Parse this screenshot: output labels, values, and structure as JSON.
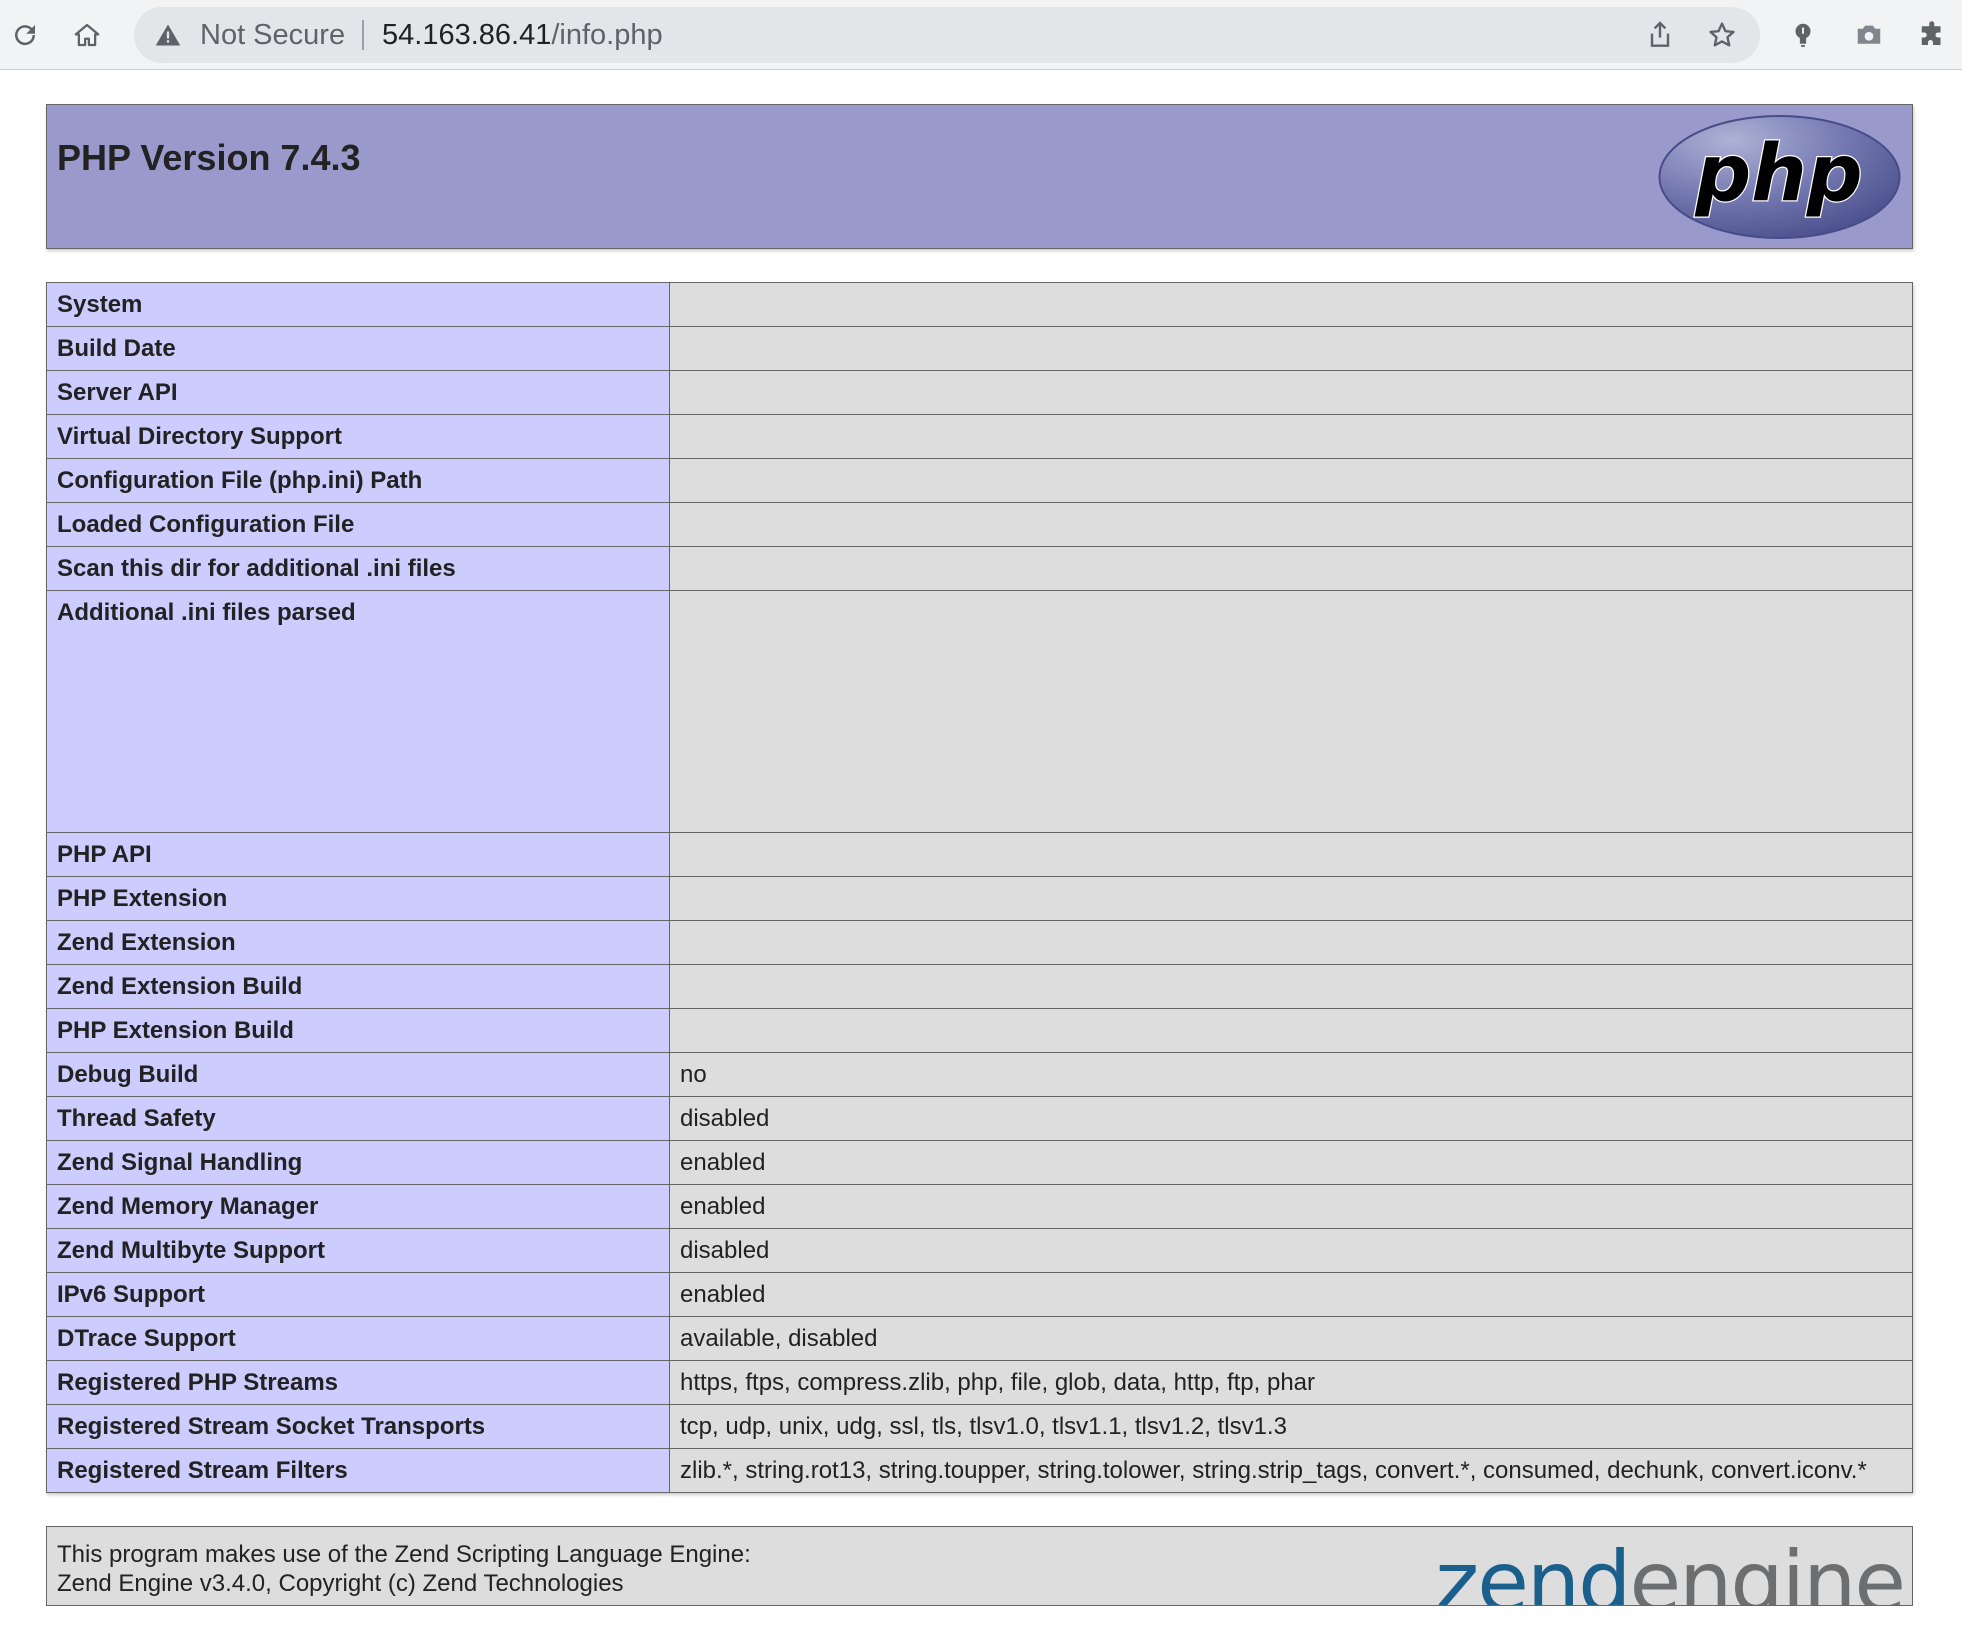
{
  "browser": {
    "security_label": "Not Secure",
    "url_host": "54.163.86.41",
    "url_path": "/info.php",
    "icons": [
      "reload-icon",
      "home-icon",
      "warning-icon",
      "share-icon",
      "bookmark-star-icon",
      "lightbulb-icon",
      "camera-icon",
      "extensions-puzzle-icon"
    ]
  },
  "page": {
    "title": "PHP Version 7.4.3",
    "logo_text": "php",
    "rows": [
      {
        "key": "System",
        "value": ""
      },
      {
        "key": "Build Date",
        "value": ""
      },
      {
        "key": "Server API",
        "value": ""
      },
      {
        "key": "Virtual Directory Support",
        "value": ""
      },
      {
        "key": "Configuration File (php.ini) Path",
        "value": ""
      },
      {
        "key": "Loaded Configuration File",
        "value": ""
      },
      {
        "key": "Scan this dir for additional .ini files",
        "value": ""
      },
      {
        "key": "Additional .ini files parsed",
        "value": ""
      },
      {
        "key": "PHP API",
        "value": ""
      },
      {
        "key": "PHP Extension",
        "value": ""
      },
      {
        "key": "Zend Extension",
        "value": ""
      },
      {
        "key": "Zend Extension Build",
        "value": ""
      },
      {
        "key": "PHP Extension Build",
        "value": ""
      },
      {
        "key": "Debug Build",
        "value": "no"
      },
      {
        "key": "Thread Safety",
        "value": "disabled"
      },
      {
        "key": "Zend Signal Handling",
        "value": "enabled"
      },
      {
        "key": "Zend Memory Manager",
        "value": "enabled"
      },
      {
        "key": "Zend Multibyte Support",
        "value": "disabled"
      },
      {
        "key": "IPv6 Support",
        "value": "enabled"
      },
      {
        "key": "DTrace Support",
        "value": "available, disabled"
      },
      {
        "key": "Registered PHP Streams",
        "value": "https, ftps, compress.zlib, php, file, glob, data, http, ftp, phar"
      },
      {
        "key": "Registered Stream Socket Transports",
        "value": "tcp, udp, unix, udg, ssl, tls, tlsv1.0, tlsv1.1, tlsv1.2, tlsv1.3"
      },
      {
        "key": "Registered Stream Filters",
        "value": "zlib.*, string.rot13, string.toupper, string.tolower, string.strip_tags, convert.*, consumed, dechunk, convert.iconv.*"
      }
    ],
    "footer": {
      "line1": "This program makes use of the Zend Scripting Language Engine:",
      "line2": "Zend Engine v3.4.0, Copyright (c) Zend Technologies",
      "logo_text": "zendengine"
    }
  },
  "colors": {
    "header_bg": "#9999cc",
    "key_bg": "#ccccff",
    "value_bg": "#dddddd",
    "zend_blue": "#1b5f8c",
    "zend_gray": "#6d6e70"
  }
}
